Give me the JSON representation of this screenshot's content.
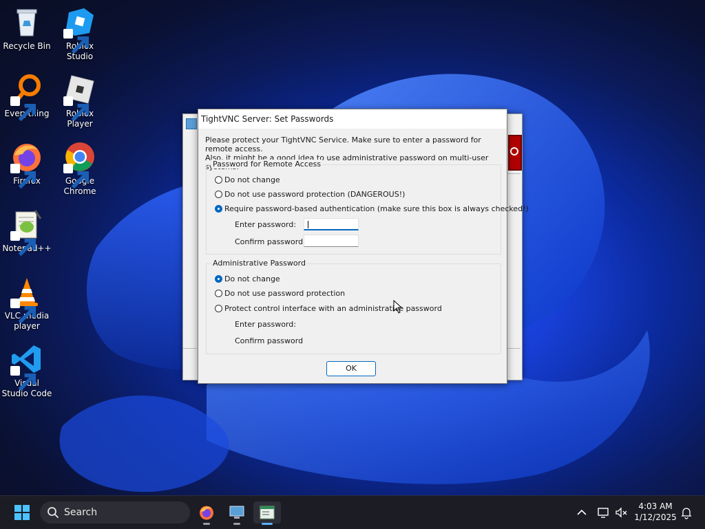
{
  "desktop": {
    "icons": [
      {
        "label": "Recycle Bin"
      },
      {
        "label": "Roblox Studio"
      },
      {
        "label": "Everything"
      },
      {
        "label": "Roblox Player"
      },
      {
        "label": "Firefox"
      },
      {
        "label": "Google Chrome"
      },
      {
        "label": "Notepad++"
      },
      {
        "label": "VLC media player"
      },
      {
        "label": "Visual Studio Code"
      }
    ]
  },
  "dialog": {
    "title": "TightVNC Server: Set Passwords",
    "intro_line1": "Please protect your TightVNC Service. Make sure to enter a password for remote access.",
    "intro_line2": "Also, it might be a good idea to use administrative password on multi-user systems.",
    "remote": {
      "group_label": "Password for Remote Access",
      "options": [
        {
          "label": "Do not change",
          "selected": false
        },
        {
          "label": "Do not use password protection (DANGEROUS!)",
          "selected": false
        },
        {
          "label": "Require password-based authentication (make sure this box is always checked!)",
          "selected": true
        }
      ],
      "enter_label": "Enter password:",
      "confirm_label": "Confirm password:",
      "enter_value": "",
      "confirm_value": ""
    },
    "admin": {
      "group_label": "Administrative Password",
      "options": [
        {
          "label": "Do not change",
          "selected": true
        },
        {
          "label": "Do not use password protection",
          "selected": false
        },
        {
          "label": "Protect control interface with an administrative password",
          "selected": false
        }
      ],
      "enter_label": "Enter password:",
      "confirm_label": "Confirm password:"
    },
    "ok_label": "OK"
  },
  "taskbar": {
    "search_label": "Search",
    "time": "4:03 AM",
    "date": "1/12/2025"
  },
  "colors": {
    "accent": "#0067c0",
    "taskbar_bg": "#1c1c24"
  }
}
